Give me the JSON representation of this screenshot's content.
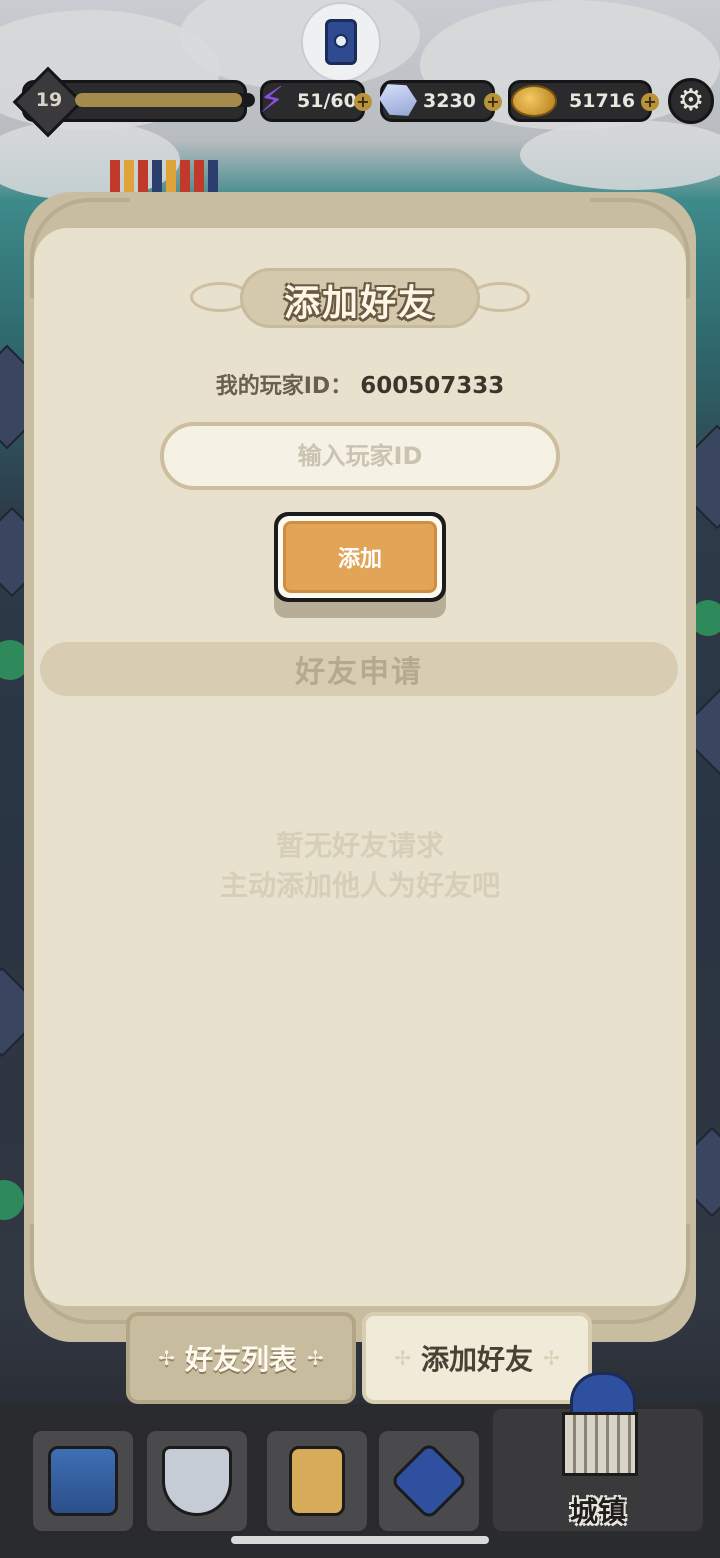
{
  "hud": {
    "level": "19",
    "xp_progress": 0.93,
    "energy": "51/60",
    "gems": "3230",
    "gold": "51716",
    "icons": {
      "record": "screen-record-icon",
      "energy": "lightning-bolt-icon",
      "gems": "crystal-icon",
      "gold": "gold-coins-icon",
      "settings": "gear-icon"
    }
  },
  "modal": {
    "title": "添加好友",
    "player_id_label": "我的玩家ID：",
    "player_id_value": "600507333",
    "input_placeholder": "输入玩家ID",
    "add_button_label": "添加",
    "section_title": "好友申请",
    "empty_line1": "暂无好友请求",
    "empty_line2": "主动添加他人为好友吧"
  },
  "tabs": [
    {
      "label": "好友列表",
      "active": false
    },
    {
      "label": "添加好友",
      "active": true
    }
  ],
  "nav": {
    "items": [
      "treasure-chest-icon",
      "sword-shield-icon",
      "armor-icon",
      "skill-dice-icon"
    ],
    "town_label": "城镇"
  },
  "colors": {
    "panel_bg": "#e7e1cd",
    "button_orange": "#e2a558",
    "hud_dark": "#2b2b2e"
  }
}
